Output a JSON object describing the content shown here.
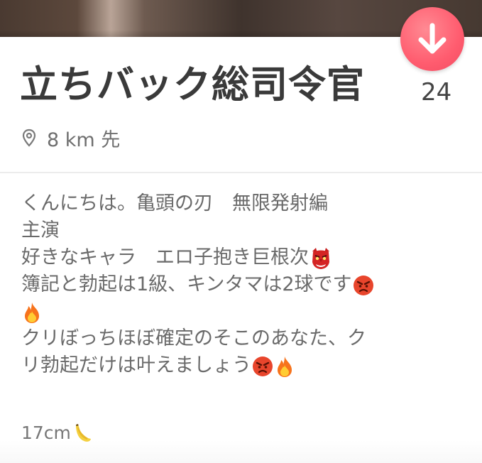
{
  "profile": {
    "name": "立ちバック総司令官",
    "age": "24",
    "distance": "8 km 先"
  },
  "icons": {
    "down_button": "arrow-down-icon",
    "location": "location-pin-icon"
  },
  "bio": {
    "line1": "くんにちは。亀頭の刃　無限発射編",
    "line2": "主演",
    "line3": "好きなキャラ　エロ子抱き巨根次",
    "line4": "簿記と勃起は1級、キンタマは2球です",
    "line6": "クリぼっちほぼ確定のそこのあなた、ク",
    "line7": "リ勃起だけは叶えましょう"
  },
  "footer": {
    "height_text": "17cm"
  },
  "colors": {
    "accent": "#ff5c6f",
    "name_text": "#3a3a3a",
    "body_text": "#6a6a6a"
  }
}
